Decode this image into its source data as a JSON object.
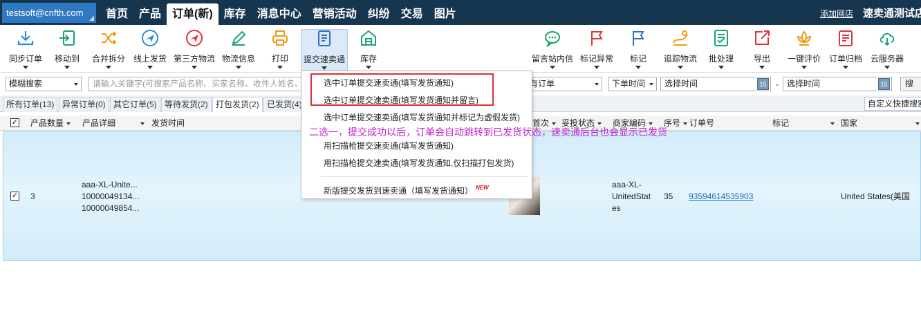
{
  "account": {
    "email": "testsoft@cnfth.com"
  },
  "nav": {
    "items": [
      "首页",
      "产品",
      "订单(新)",
      "库存",
      "消息中心",
      "营销活动",
      "纠纷",
      "交易",
      "图片"
    ],
    "active_index": 2,
    "add_shop": "添加网店",
    "store_name": "速卖通测试店"
  },
  "toolbar": {
    "left": [
      {
        "label": "同步订单",
        "icon": "download-icon",
        "color": "#2a8ad8"
      },
      {
        "label": "移动到",
        "icon": "move-to-icon",
        "color": "#1aa36b"
      },
      {
        "label": "合并拆分",
        "icon": "shuffle-icon",
        "color": "#f29a10"
      },
      {
        "label": "线上发货",
        "icon": "plane-icon",
        "color": "#2a8ad8"
      },
      {
        "label": "第三方物流",
        "icon": "plane-red-icon",
        "color": "#e0333a"
      },
      {
        "label": "物流信息",
        "icon": "pencil-icon",
        "color": "#1aa36b"
      },
      {
        "label": "打印",
        "icon": "printer-icon",
        "color": "#f29a10"
      },
      {
        "label": "提交速卖通",
        "icon": "document-icon",
        "color": "#2a6fc0"
      },
      {
        "label": "库存",
        "icon": "warehouse-icon",
        "color": "#1aa36b"
      }
    ],
    "right": [
      {
        "label": "留言站内信",
        "icon": "chat-icon",
        "color": "#1aa36b"
      },
      {
        "label": "标记异常",
        "icon": "flag-red-icon",
        "color": "#e0333a"
      },
      {
        "label": "标记",
        "icon": "flag-blue-icon",
        "color": "#2a6fc0"
      },
      {
        "label": "追踪物流",
        "icon": "track-icon",
        "color": "#f29a10"
      },
      {
        "label": "批处理",
        "icon": "batch-icon",
        "color": "#1aa36b"
      },
      {
        "label": "导出",
        "icon": "export-icon",
        "color": "#e0333a"
      },
      {
        "label": "一键评价",
        "icon": "lotus-icon",
        "color": "#f29a10"
      },
      {
        "label": "订单归档",
        "icon": "archive-icon",
        "color": "#e0333a"
      },
      {
        "label": "云服务器",
        "icon": "cloud-icon",
        "color": "#1aa36b"
      }
    ]
  },
  "filter": {
    "search_mode": "模糊搜索",
    "keyword_placeholder": "请输入关键字(可搜索产品名称、买家名称、收件人姓名、",
    "order_scope": "有订单",
    "time_type": "下单时间",
    "start_placeholder": "选择时间",
    "dash": "-",
    "end_placeholder": "选择时间",
    "calendar_day": "15",
    "search_label": "搜"
  },
  "tabs": {
    "items": [
      "所有订单(13)",
      "异常订单(0)",
      "其它订单(5)",
      "等待发货(2)",
      "打包发货(2)",
      "已发货(4)"
    ],
    "active_index": 4,
    "quick_search": "自定义快捷搜索"
  },
  "table": {
    "headers": [
      "产品数量",
      "产品详细",
      "发货时间",
      "首次",
      "妥投状态",
      "商家编码",
      "序号",
      "订单号",
      "标记",
      "国家"
    ],
    "row": {
      "checked": true,
      "quantity": "3",
      "product_line1": "aaa-XL-Unite...",
      "product_line2": "10000049134...",
      "product_line3": "10000049854...",
      "merchant_code_1": "aaa-XL-",
      "merchant_code_2": "UnitedStat",
      "merchant_code_3": "es",
      "serial": "35",
      "order_no": "93594614535903",
      "country": "United States(美国"
    }
  },
  "dropdown": {
    "items": [
      "选中订单提交速卖通(填写发货通知)",
      "选中订单提交速卖通(填写发货通知并留言)",
      "选中订单提交速卖通(填写发货通知并标记为虚假发货)",
      "用扫描枪提交速卖通(填写发货通知)",
      "用扫描枪提交速卖通(填写发货通知,仅扫描打包发货)",
      "新版提交发货到速卖通（填写发货通知）"
    ],
    "new_badge": "NEW"
  },
  "annotation": "二选一，提交成功以后，订单会自动跳转到已发货状态，速卖通后台也会显示已发货"
}
